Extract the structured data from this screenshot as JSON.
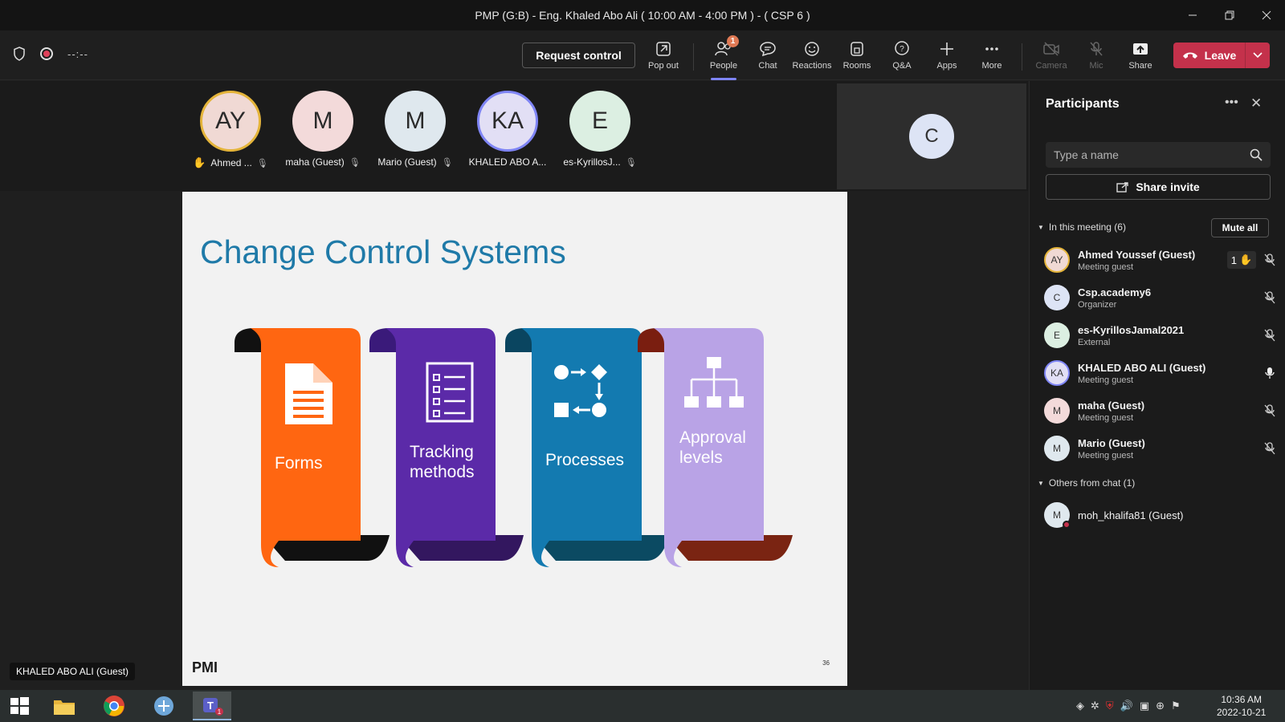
{
  "window": {
    "title": "PMP (G:B) - Eng. Khaled Abo Ali ( 10:00 AM - 4:00 PM ) - ( CSP 6 )"
  },
  "toolbar": {
    "timer": "--:--",
    "request_control": "Request control",
    "pop_out": "Pop out",
    "people": "People",
    "people_badge": "1",
    "chat": "Chat",
    "reactions": "Reactions",
    "rooms": "Rooms",
    "qa": "Q&A",
    "apps": "Apps",
    "more": "More",
    "camera": "Camera",
    "mic": "Mic",
    "share": "Share",
    "leave": "Leave"
  },
  "strip": {
    "tiles": [
      {
        "initials": "AY",
        "name": "Ahmed ..."
      },
      {
        "initials": "M",
        "name": "maha (Guest)"
      },
      {
        "initials": "M",
        "name": "Mario (Guest)"
      },
      {
        "initials": "KA",
        "name": "KHALED ABO A..."
      },
      {
        "initials": "E",
        "name": "es-KyrillosJ..."
      }
    ],
    "extra_tile": {
      "initials": "C"
    }
  },
  "slide": {
    "title": "Change Control Systems",
    "items": [
      {
        "label": "Forms",
        "color": "#ff6611"
      },
      {
        "label": "Tracking methods",
        "color": "#5b2aa8"
      },
      {
        "label": "Processes",
        "color": "#137ab0"
      },
      {
        "label": "Approval levels",
        "color": "#b9a3e6"
      }
    ],
    "logo": "PMI",
    "page_number": "36"
  },
  "presenter_chip": "KHALED ABO ALI (Guest)",
  "panel": {
    "title": "Participants",
    "search_placeholder": "Type a name",
    "share_invite": "Share invite",
    "in_meeting": "In this meeting (6)",
    "mute_all": "Mute all",
    "participants": [
      {
        "initials": "AY",
        "name": "Ahmed Youssef (Guest)",
        "role": "Meeting guest",
        "hand": "1"
      },
      {
        "initials": "C",
        "name": "Csp.academy6",
        "role": "Organizer"
      },
      {
        "initials": "E",
        "name": "es-KyrillosJamal2021",
        "role": "External"
      },
      {
        "initials": "KA",
        "name": "KHALED ABO ALI (Guest)",
        "role": "Meeting guest"
      },
      {
        "initials": "M",
        "name": "maha (Guest)",
        "role": "Meeting guest"
      },
      {
        "initials": "M",
        "name": "Mario (Guest)",
        "role": "Meeting guest"
      }
    ],
    "others_head": "Others from chat (1)",
    "others": [
      {
        "initials": "M",
        "name": "moh_khalifa81 (Guest)"
      }
    ]
  },
  "taskbar": {
    "time": "10:36 AM",
    "date": "2022-10-21"
  },
  "colors": {
    "accent": "#7f85f5",
    "leave": "#c4314b"
  }
}
